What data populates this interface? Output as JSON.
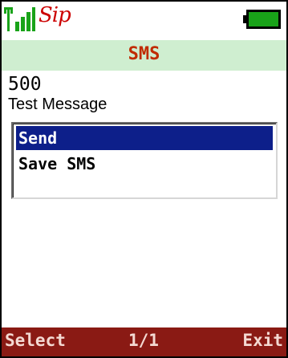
{
  "status_bar": {
    "sip_label": "Sip",
    "signal_icon": "signal-strength-icon",
    "battery_icon": "battery-full-icon"
  },
  "header": {
    "title": "SMS"
  },
  "compose": {
    "recipient": "500",
    "message": "Test Message"
  },
  "options": {
    "items": [
      {
        "label": "Send",
        "selected": true
      },
      {
        "label": "Save SMS",
        "selected": false
      }
    ]
  },
  "softkeys": {
    "left": "Select",
    "center": "1/1",
    "right": "Exit"
  },
  "colors": {
    "title_bar_bg": "#cfeed0",
    "title_text": "#c02b00",
    "selection_bg": "#0d1f8a",
    "softkey_bar_bg": "#8a1a14",
    "softkey_text": "#f4d9d2",
    "battery_fill": "#19a319",
    "sip_text": "#cc0000"
  }
}
